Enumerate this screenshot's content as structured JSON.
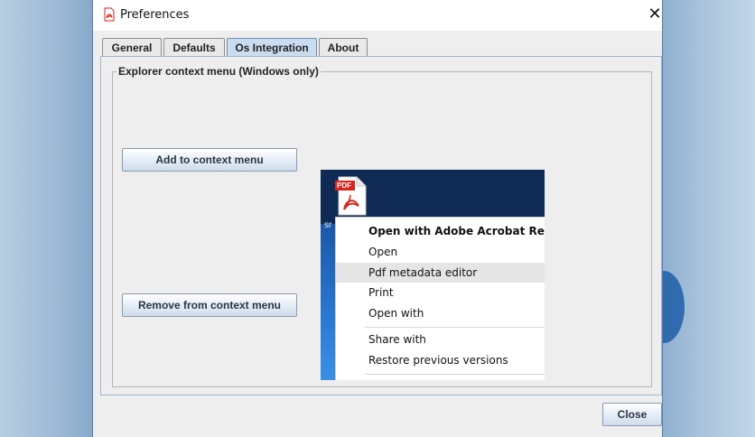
{
  "window": {
    "title": "Preferences",
    "close_glyph": "✕"
  },
  "tabs": [
    {
      "label": "General",
      "active": false
    },
    {
      "label": "Defaults",
      "active": false
    },
    {
      "label": "Os Integration",
      "active": true
    },
    {
      "label": "About",
      "active": false
    }
  ],
  "os_integration": {
    "group_title": "Explorer context menu (Windows only)",
    "add_button": "Add to context menu",
    "remove_button": "Remove from context menu"
  },
  "preview": {
    "file_badge": "PDF",
    "file_caption": "sr",
    "context_menu": [
      {
        "label": "Open with Adobe Acrobat Reader DC",
        "bold": true
      },
      {
        "label": "Open"
      },
      {
        "label": "Pdf metadata editor",
        "highlighted": true
      },
      {
        "label": "Print"
      },
      {
        "label": "Open with"
      },
      {
        "label": "Share with"
      },
      {
        "label": "Restore previous versions"
      }
    ]
  },
  "footer": {
    "close_button": "Close"
  },
  "colors": {
    "active_tab": "#c9dcf0",
    "pdf_red": "#d7261f",
    "desktop_blue": "#11335f"
  }
}
